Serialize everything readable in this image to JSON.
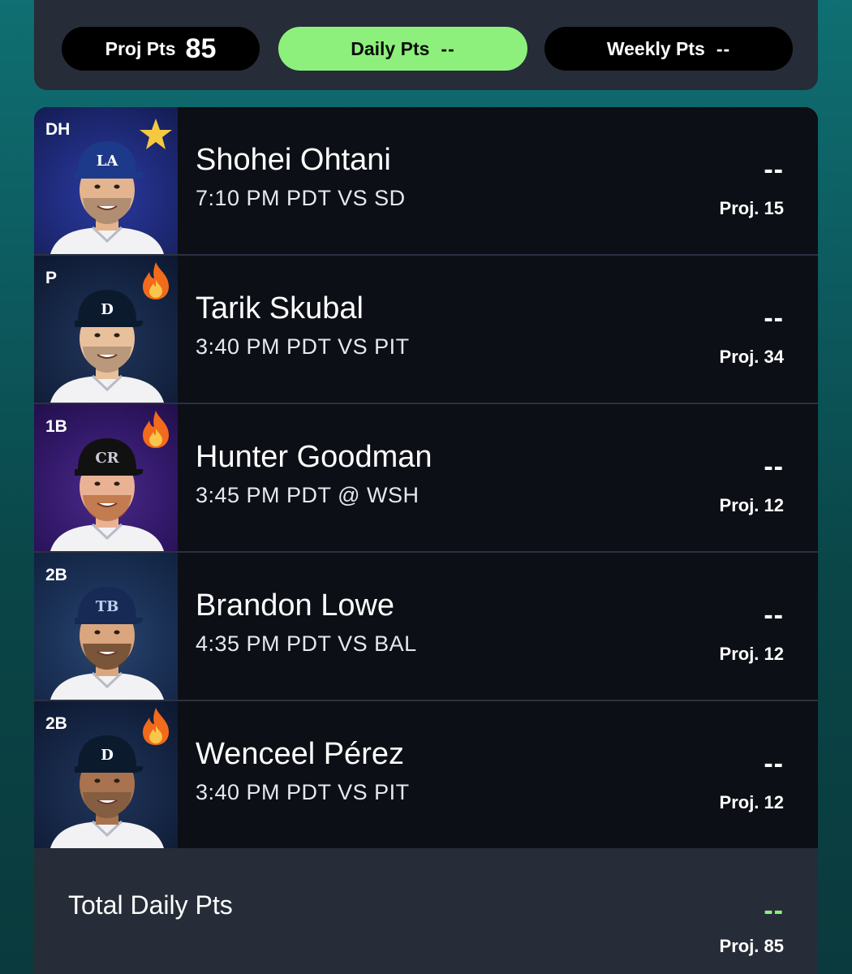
{
  "header": {
    "proj_pts_label": "Proj Pts",
    "proj_pts_value": "85",
    "daily_pts_label": "Daily Pts",
    "daily_pts_value": "--",
    "weekly_pts_label": "Weekly Pts",
    "weekly_pts_value": "--"
  },
  "players": [
    {
      "position": "DH",
      "name": "Shohei Ohtani",
      "game": "7:10 PM PDT  VS  SD",
      "points": "--",
      "projection": "Proj. 15",
      "badge": "star-icon",
      "cap_logo": "LA",
      "bg": "blue"
    },
    {
      "position": "P",
      "name": "Tarik Skubal",
      "game": "3:40 PM PDT  VS  PIT",
      "points": "--",
      "projection": "Proj. 34",
      "badge": "fire-icon",
      "cap_logo": "D",
      "bg": "navy"
    },
    {
      "position": "1B",
      "name": "Hunter Goodman",
      "game": "3:45 PM PDT  @  WSH",
      "points": "--",
      "projection": "Proj. 12",
      "badge": "fire-icon",
      "cap_logo": "CR",
      "bg": "purple"
    },
    {
      "position": "2B",
      "name": "Brandon Lowe",
      "game": "4:35 PM PDT  VS  BAL",
      "points": "--",
      "projection": "Proj. 12",
      "badge": "",
      "cap_logo": "TB",
      "bg": "steel"
    },
    {
      "position": "2B",
      "name": "Wenceel Pérez",
      "game": "3:40 PM PDT  VS  PIT",
      "points": "--",
      "projection": "Proj. 12",
      "badge": "fire-icon",
      "cap_logo": "D",
      "bg": "navy"
    }
  ],
  "total": {
    "label": "Total Daily Pts",
    "points": "--",
    "projection": "Proj. 85"
  },
  "colors": {
    "accent_green": "#8ef07c",
    "card_bg": "#262d38",
    "row_bg": "#0c0f15",
    "star": "#f5c842",
    "fire": "#f26a1b"
  }
}
